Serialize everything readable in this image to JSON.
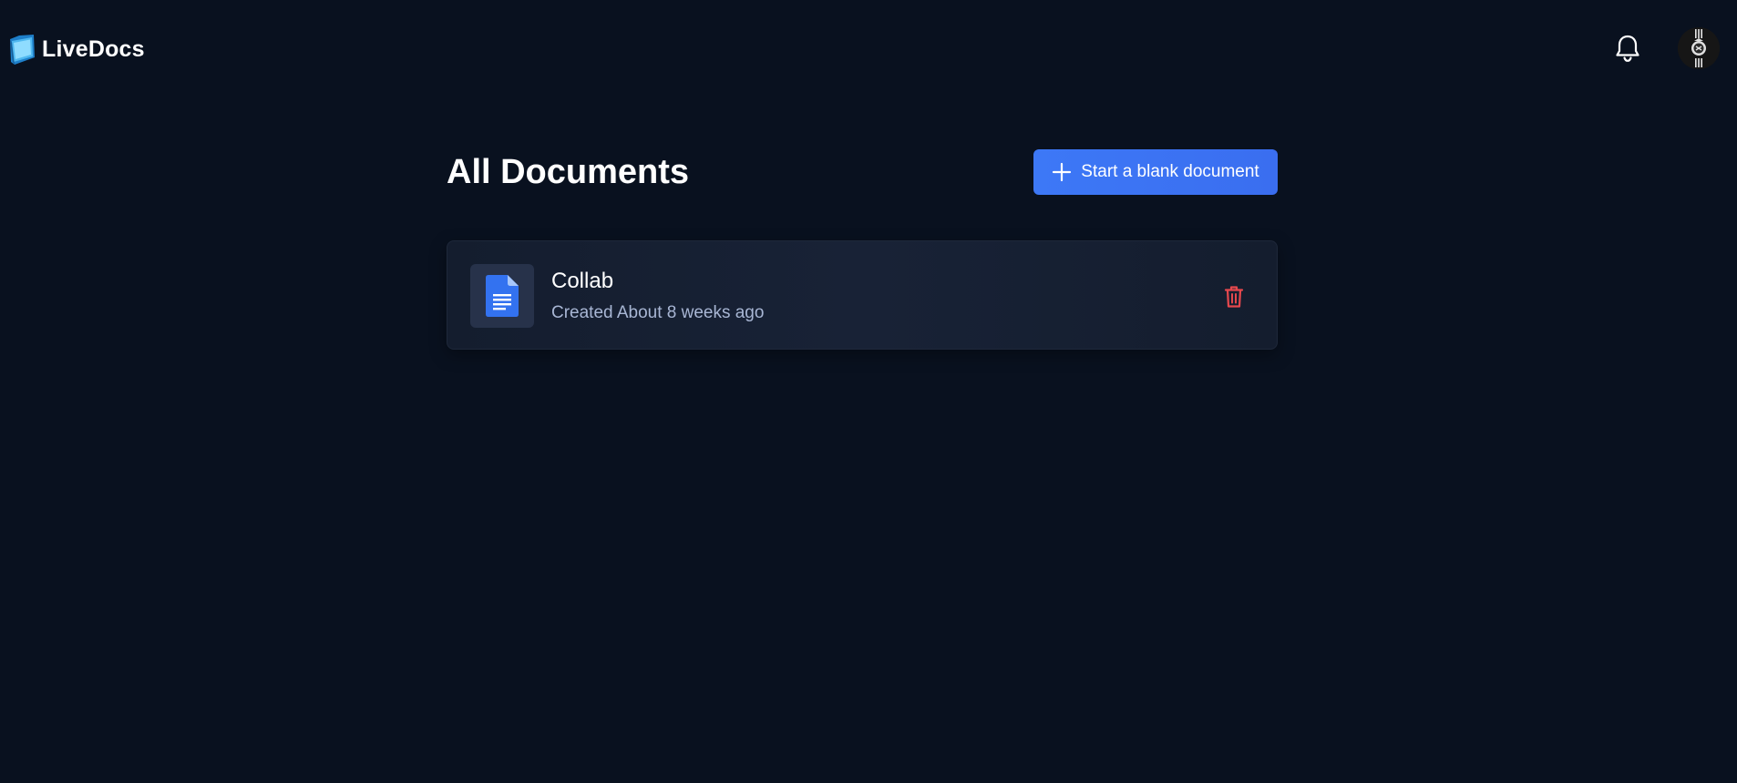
{
  "app": {
    "name": "LiveDocs"
  },
  "header": {
    "notifications_icon": "bell-icon",
    "avatar_icon": "user-avatar"
  },
  "main": {
    "title": "All Documents",
    "new_document_button": {
      "label": "Start a blank document",
      "icon": "plus-icon"
    },
    "documents": [
      {
        "title": "Collab",
        "created": "Created About 8 weeks ago",
        "icon": "document-icon",
        "delete_icon": "trash-icon"
      }
    ]
  },
  "colors": {
    "background": "#09111f",
    "accent": "#3d78f6",
    "card": "#161f31",
    "danger": "#e5484d",
    "muted_text": "#a8b6d4"
  }
}
